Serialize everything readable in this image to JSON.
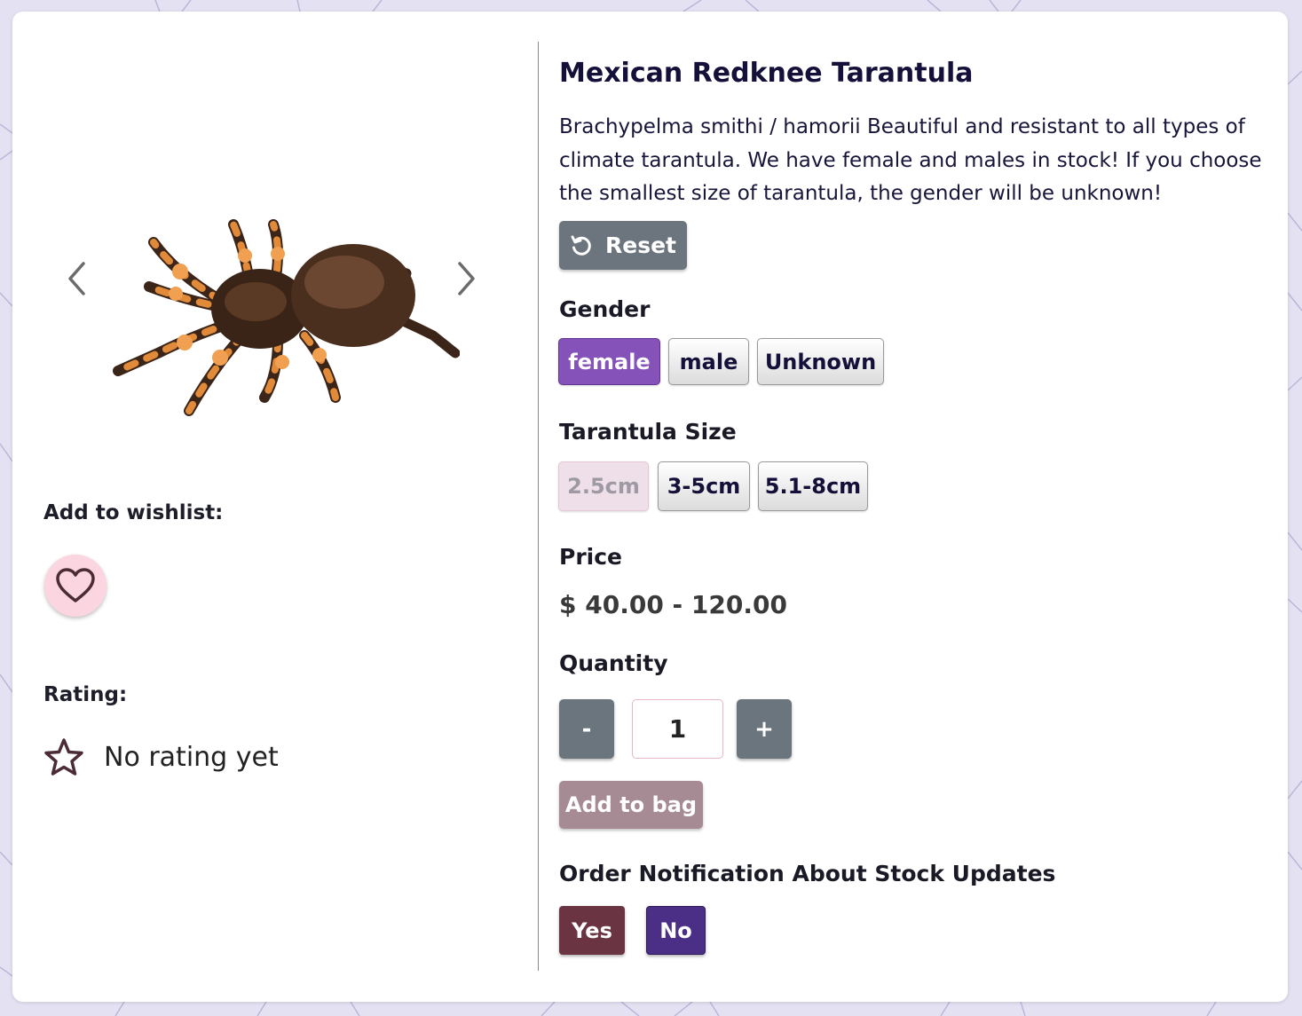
{
  "product": {
    "title": "Mexican Redknee Tarantula",
    "description": "Brachypelma smithi / hamorii Beautiful and resistant to all types of climate tarantula. We have female and males in stock! If you choose the smallest size of tarantula, the gender will be unknown!",
    "image_alt": "Mexican Redknee Tarantula"
  },
  "left": {
    "wishlist_label": "Add to wishlist:",
    "rating_label": "Rating:",
    "rating_text": "No rating yet"
  },
  "actions": {
    "reset_label": "Reset",
    "add_to_bag_label": "Add to bag"
  },
  "gender": {
    "label": "Gender",
    "options": [
      "female",
      "male",
      "Unknown"
    ],
    "selected": "female"
  },
  "size": {
    "label": "Tarantula Size",
    "options": [
      "2.5cm",
      "3-5cm",
      "5.1-8cm"
    ],
    "disabled": "2.5cm"
  },
  "price": {
    "label": "Price",
    "value": "$ 40.00 - 120.00"
  },
  "quantity": {
    "label": "Quantity",
    "decrement_label": "-",
    "increment_label": "+",
    "value": "1"
  },
  "notification": {
    "label": "Order Notification About Stock Updates",
    "yes_label": "Yes",
    "no_label": "No"
  },
  "colors": {
    "background": "#e4e2f2",
    "selected_option": "#8552b9",
    "reset_button": "#6c757e",
    "add_to_bag": "#a68a94",
    "yes_button": "#6a3442",
    "no_button": "#4b2f86",
    "wishlist_button": "#fbd5df"
  }
}
